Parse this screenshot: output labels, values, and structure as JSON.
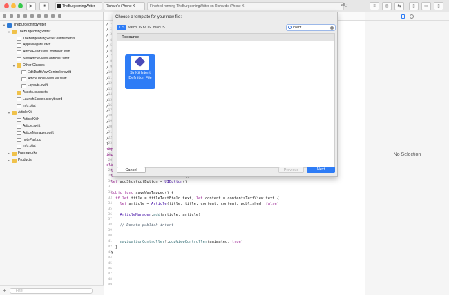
{
  "toolbar": {
    "scheme_target": "TheBurgeoningWriter",
    "device": "Richard's iPhone X",
    "status": "Finished running TheBurgeoningWriter on Richard's iPhone X",
    "editor_corner": "ell_t"
  },
  "navigator": {
    "items": [
      {
        "label": "TheBurgeoningWriter",
        "type": "project",
        "disclosure": "open",
        "depth": 0
      },
      {
        "label": "TheBurgeoningWriter",
        "type": "folder",
        "disclosure": "open",
        "depth": 1
      },
      {
        "label": "TheBurgeoningWriter.entitlements",
        "type": "file",
        "depth": 2
      },
      {
        "label": "AppDelegate.swift",
        "type": "file",
        "depth": 2
      },
      {
        "label": "ArticleFeedViewController.swift",
        "type": "file",
        "depth": 2
      },
      {
        "label": "NewArticleViewController.swift",
        "type": "file",
        "depth": 2
      },
      {
        "label": "Other Classes",
        "type": "folder",
        "disclosure": "open",
        "depth": 2
      },
      {
        "label": "EditDraftViewController.swift",
        "type": "file",
        "depth": 3
      },
      {
        "label": "ArticleTableViewCell.swift",
        "type": "file",
        "depth": 3
      },
      {
        "label": "Layouts.swift",
        "type": "file",
        "depth": 3
      },
      {
        "label": "Assets.xcassets",
        "type": "folder",
        "depth": 2
      },
      {
        "label": "LaunchScreen.storyboard",
        "type": "file",
        "depth": 2
      },
      {
        "label": "Info.plist",
        "type": "file",
        "depth": 2
      },
      {
        "label": "ArticleKit",
        "type": "folder",
        "disclosure": "open",
        "depth": 1
      },
      {
        "label": "ArticleKit.h",
        "type": "file",
        "depth": 2
      },
      {
        "label": "Article.swift",
        "type": "file",
        "depth": 2
      },
      {
        "label": "ArticleManager.swift",
        "type": "file",
        "depth": 2
      },
      {
        "label": "notePad.jpg",
        "type": "file",
        "depth": 2
      },
      {
        "label": "Info.plist",
        "type": "file",
        "depth": 2
      },
      {
        "label": "Frameworks",
        "type": "folder",
        "disclosure": "closed",
        "depth": 1
      },
      {
        "label": "Products",
        "type": "folder",
        "disclosure": "closed",
        "depth": 1
      }
    ],
    "filter_placeholder": "Filter"
  },
  "sheet": {
    "title": "Choose a template for your new file:",
    "platforms": [
      "iOS",
      "watchOS",
      "tvOS",
      "macOS"
    ],
    "selected_platform": "iOS",
    "search_value": "intent",
    "section": "Resource",
    "template": "SiriKit Intent Definition File",
    "cancel_label": "Cancel",
    "previous_label": "Previous",
    "next_label": "Next"
  },
  "editor": {
    "slash_lines": 22,
    "lines": [
      {
        "n": "",
        "text": "}"
      },
      {
        "n": "",
        "text": "import IntentsUI"
      },
      {
        "n": "",
        "text": "import ArticleKit"
      },
      {
        "n": "",
        "text": ""
      },
      {
        "n": "",
        "text": "class NewArticleViewController: UIViewController {"
      },
      {
        "n": "",
        "text": "  let titleTextField = UITextField()"
      },
      {
        "n": "",
        "text": "  let contentsTextView = UITextView()"
      },
      {
        "n": "",
        "text": "  let addShortcutButton = UIButton()"
      },
      {
        "n": "",
        "text": ""
      },
      {
        "n": "",
        "text": "  @objc func saveWasTapped() {"
      },
      {
        "n": "",
        "text": "    if let title = titleTextField.text, let content = contentsTextView.text {"
      },
      {
        "n": "",
        "text": "      let article = Article(title: title, content: content, published: false)"
      },
      {
        "n": "",
        "text": ""
      },
      {
        "n": "",
        "text": "      ArticleManager.add(article: article)"
      },
      {
        "n": "",
        "text": ""
      },
      {
        "n": "",
        "text": "      // Donate publish intent"
      },
      {
        "n": "",
        "text": ""
      },
      {
        "n": "",
        "text": ""
      },
      {
        "n": "",
        "text": "      navigationController?.popViewController(animated: true)"
      },
      {
        "n": "",
        "text": "    }"
      },
      {
        "n": "",
        "text": "  }"
      }
    ],
    "line_numbers": [
      "1",
      "2",
      "3",
      "4",
      "5",
      "6",
      "7",
      "8",
      "9",
      "10",
      "11",
      "12",
      "13",
      "14",
      "15",
      "16",
      "17",
      "18",
      "19",
      "20",
      "21",
      "22",
      "23",
      "24",
      "25",
      "26",
      "27",
      "28",
      "29",
      "30",
      "31",
      "32",
      "33",
      "34",
      "35",
      "36",
      "37",
      "38",
      "39",
      "40",
      "41",
      "42",
      "43",
      "44",
      "45",
      "46",
      "47",
      "48",
      "49"
    ]
  },
  "inspector": {
    "empty_label": "No Selection"
  }
}
